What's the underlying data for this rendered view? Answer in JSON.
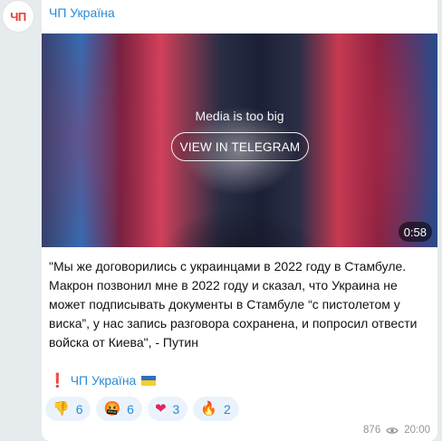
{
  "channel": {
    "avatar_text": "ЧП",
    "name": "ЧП Україна"
  },
  "media": {
    "message": "Media is too big",
    "button_label": "VIEW IN TELEGRAM",
    "duration": "0:58"
  },
  "post": {
    "text": "\"Мы же договорились с украинцами в 2022 году в Стамбуле. Макрон позвонил мне в 2022 году и сказал, что Украина не может подписывать документы в Стамбуле “с пистолетом у виска”, у нас запись разговора сохранена, и попросил отвести войска от Киева\", - Путин",
    "signature_mark": "❗",
    "signature_text": "ЧП Україна"
  },
  "reactions": [
    {
      "emoji": "👎",
      "icon": "thumbs-down-icon",
      "count": "6"
    },
    {
      "emoji": "🤬",
      "icon": "angry-face-icon",
      "count": "6"
    },
    {
      "emoji": "❤",
      "icon": "heart-icon",
      "count": "3"
    },
    {
      "emoji": "🔥",
      "icon": "fire-icon",
      "count": "2"
    }
  ],
  "meta": {
    "views": "876",
    "time": "20:00"
  },
  "colors": {
    "link": "#2a8bd8",
    "background": "#e6ebee",
    "bubble": "#ffffff",
    "reaction_bg": "#eaf3fb"
  }
}
